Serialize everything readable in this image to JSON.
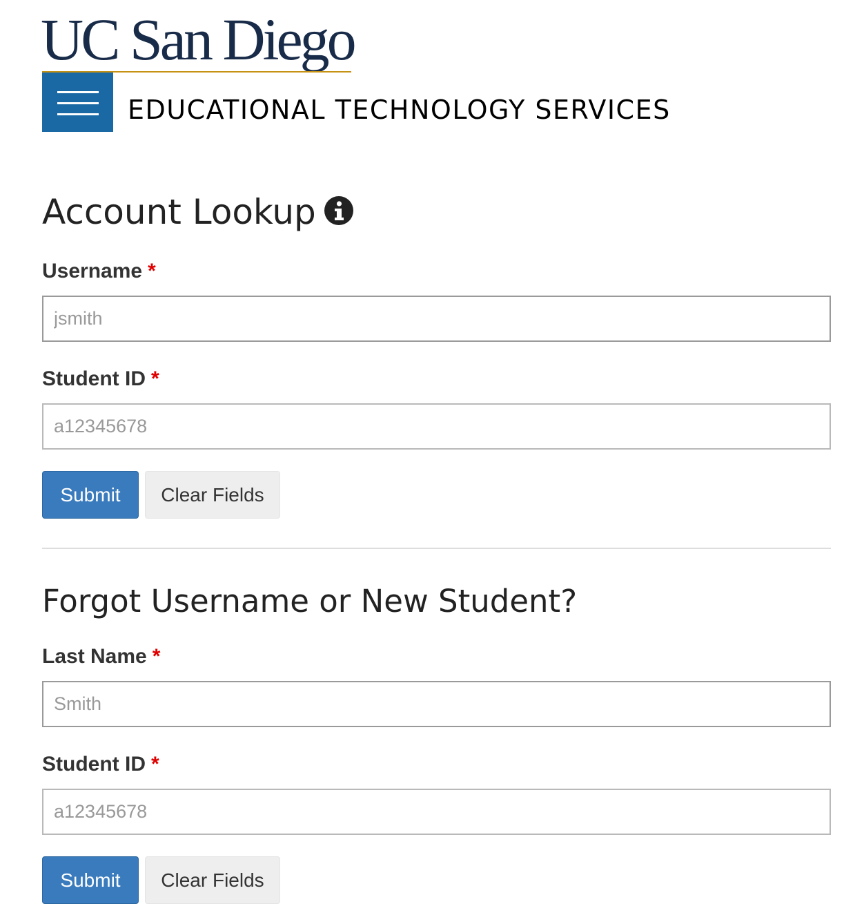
{
  "logo": {
    "text": "UC San Diego"
  },
  "header": {
    "menu_icon": "hamburger-menu-icon",
    "site_name": "EDUCATIONAL TECHNOLOGY SERVICES",
    "brand_color": "#1a69a4",
    "logo_color": "#182b49",
    "logo_rule_color": "#c69214"
  },
  "account_lookup": {
    "title": "Account Lookup",
    "info_icon": "info-circle-icon",
    "username_label": "Username",
    "username_placeholder": "jsmith",
    "student_id_label": "Student ID",
    "student_id_placeholder": "a12345678",
    "required_marker": "*",
    "submit_label": "Submit",
    "clear_label": "Clear Fields"
  },
  "forgot_username": {
    "title": "Forgot Username or New Student?",
    "last_name_label": "Last Name",
    "last_name_placeholder": "Smith",
    "student_id_label": "Student ID",
    "student_id_placeholder": "a12345678",
    "required_marker": "*",
    "submit_label": "Submit",
    "clear_label": "Clear Fields"
  },
  "colors": {
    "submit_button": "#3a7bbd",
    "clear_button": "#eeeeee",
    "required": "#e00000"
  }
}
